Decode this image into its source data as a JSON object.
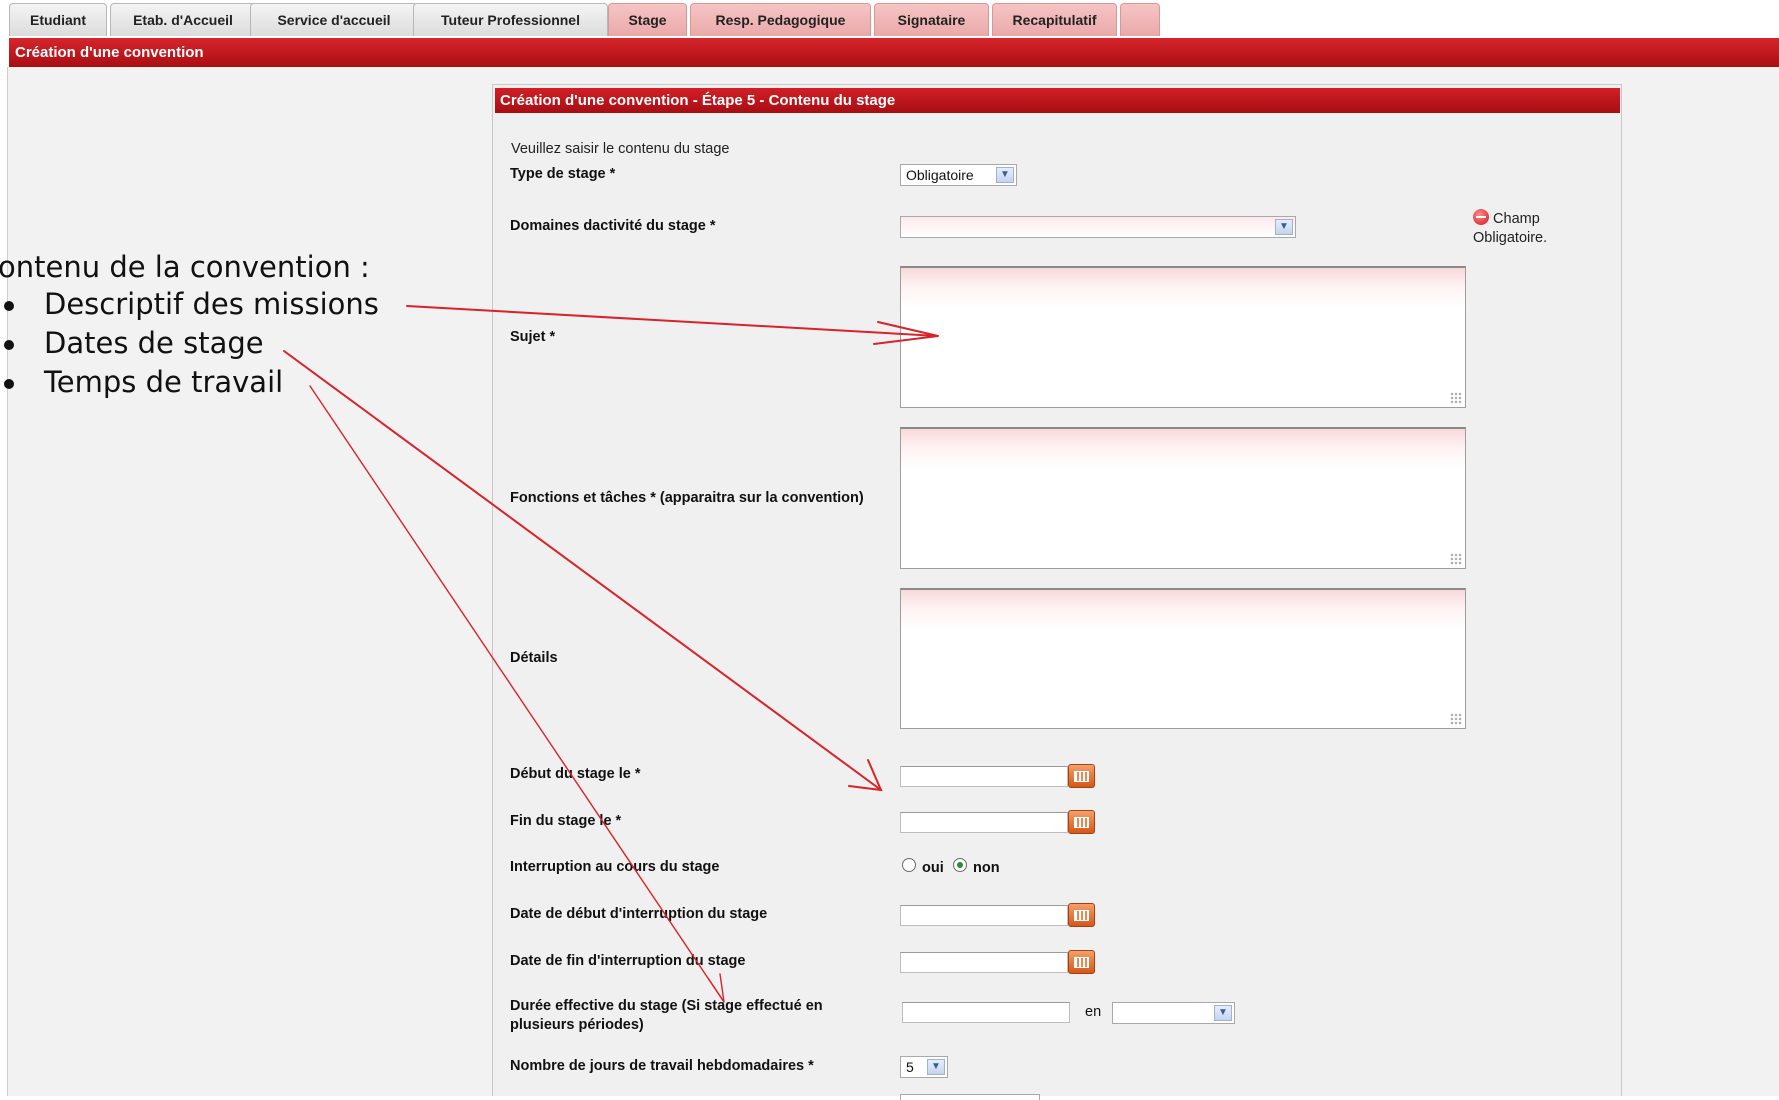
{
  "tabs": [
    {
      "label": "Etudiant",
      "state": "normal"
    },
    {
      "label": "Etab. d'Accueil",
      "state": "normal"
    },
    {
      "label": "Service d'accueil",
      "state": "normal"
    },
    {
      "label": "Tuteur Professionnel",
      "state": "normal"
    },
    {
      "label": "Stage",
      "state": "active"
    },
    {
      "label": "Resp. Pedagogique",
      "state": "highlighted"
    },
    {
      "label": "Signataire",
      "state": "highlighted"
    },
    {
      "label": "Recapitulatif",
      "state": "highlighted"
    },
    {
      "label": "",
      "state": "highlighted"
    }
  ],
  "main_title": "Création d'une convention",
  "panel": {
    "title": "Création d'une convention - Étape 5 - Contenu du stage",
    "intro": "Veuillez saisir le contenu du stage",
    "required_note_line1": "Champ",
    "required_note_line2": "Obligatoire.",
    "fields": {
      "type_stage": {
        "label": "Type de stage *",
        "value": "Obligatoire"
      },
      "domaines": {
        "label": "Domaines dactivité du stage *",
        "value": ""
      },
      "sujet": {
        "label": "Sujet *",
        "value": ""
      },
      "fonctions": {
        "label": "Fonctions et tâches * (apparaitra sur la convention)",
        "value": ""
      },
      "details": {
        "label": "Détails",
        "value": ""
      },
      "debut": {
        "label": "Début du stage le *",
        "value": ""
      },
      "fin": {
        "label": "Fin du stage le *",
        "value": ""
      },
      "interruption": {
        "label": "Interruption au cours du stage",
        "opt_oui": "oui",
        "opt_non": "non",
        "selected": "non"
      },
      "debut_interruption": {
        "label": "Date de début d'interruption du stage",
        "value": ""
      },
      "fin_interruption": {
        "label": "Date de fin d'interruption du stage",
        "value": ""
      },
      "duree": {
        "label_line1": "Durée effective du stage (Si stage effectué en",
        "label_line2": "plusieurs périodes)",
        "value": "",
        "unit_prefix": "en",
        "unit": ""
      },
      "jours": {
        "label": "Nombre de jours de travail hebdomadaires *",
        "value": "5"
      }
    }
  },
  "annotation": {
    "heading": "ontenu de la convention :",
    "items": [
      "Descriptif des missions",
      "Dates de stage",
      "Temps de travail"
    ],
    "color": "#d8232a"
  },
  "colors": {
    "brand_red": "#c4161c",
    "required_bg": "#fde9ea",
    "tab_highlight": "#f0b6b6"
  }
}
